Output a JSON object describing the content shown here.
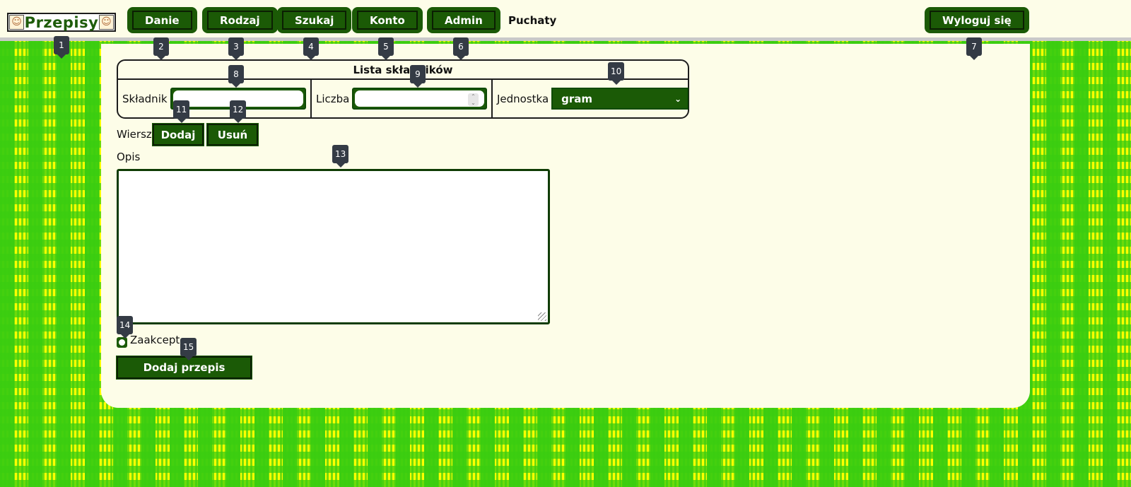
{
  "header": {
    "logo_text": "Przepisy",
    "nav": [
      {
        "label": "Danie"
      },
      {
        "label": "Rodzaj"
      },
      {
        "label": "Szukaj"
      },
      {
        "label": "Konto"
      },
      {
        "label": "Admin"
      }
    ],
    "username": "Puchaty",
    "logout_label": "Wyloguj się"
  },
  "ingredients": {
    "title": "Lista składników",
    "ingredient_label": "Składnik",
    "ingredient_value": "",
    "amount_label": "Liczba",
    "amount_value": "",
    "unit_label": "Jednostka",
    "unit_selected": "gram"
  },
  "row_controls": {
    "label": "Wiersz",
    "add_label": "Dodaj",
    "remove_label": "Usuń"
  },
  "description": {
    "label": "Opis",
    "value": ""
  },
  "accept": {
    "label": "Zaakcept",
    "checked": true
  },
  "submit_label": "Dodaj przepis",
  "markers": [
    "1",
    "2",
    "3",
    "4",
    "5",
    "6",
    "7",
    "8",
    "9",
    "10",
    "11",
    "12",
    "13",
    "14",
    "15"
  ],
  "colors": {
    "button_green": "#1b5a06",
    "panel_bg": "#fdfde8",
    "check_green": "#3acd10",
    "check_yellow": "#ffff00",
    "marker_bg": "#343b45"
  }
}
